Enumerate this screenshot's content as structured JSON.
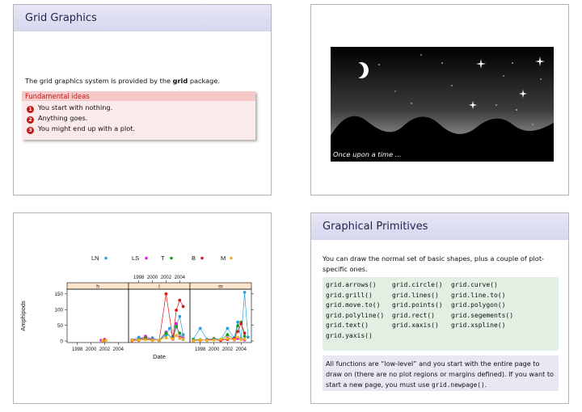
{
  "slide1": {
    "title": "Grid Graphics",
    "intro_before": "The grid graphics system is provided by the ",
    "intro_bold": "grid",
    "intro_after": " package.",
    "block_title": "Fundamental ideas",
    "items": [
      {
        "num": "1",
        "text": "You start with nothing."
      },
      {
        "num": "2",
        "text": "Anything goes."
      },
      {
        "num": "3",
        "text": "You might end up with a plot."
      }
    ],
    "accent": "#c41616"
  },
  "slide2": {
    "caption": "Once upon a time ..."
  },
  "slide3": {
    "chart_data": {
      "type": "line",
      "panels": [
        "h",
        "l",
        "m"
      ],
      "legend": [
        "LN",
        "LS",
        "T",
        "B",
        "M"
      ],
      "legend_colors": [
        "#2aa0dc",
        "#e020e0",
        "#11a011",
        "#e01515",
        "#f0b020"
      ],
      "xlabel": "Date",
      "ylabel": "Amphipods",
      "x_ticks": [
        "1998",
        "2000",
        "2002",
        "2004"
      ],
      "y_ticks": [
        "0",
        "50",
        "100",
        "150"
      ],
      "xlim": [
        1996.5,
        2005.5
      ],
      "ylim": [
        -5,
        165
      ],
      "series": [
        {
          "name": "LN",
          "color": "#2aa0dc",
          "data": [
            [],
            [
              [
                1997,
                3
              ],
              [
                1998,
                12
              ],
              [
                1999,
                5
              ],
              [
                2000,
                10
              ],
              [
                2001,
                3
              ],
              [
                2002,
                18
              ],
              [
                2002.5,
                40
              ],
              [
                2003,
                15
              ],
              [
                2003.5,
                50
              ],
              [
                2004,
                78
              ],
              [
                2004.5,
                20
              ]
            ],
            [
              [
                1997,
                6
              ],
              [
                1998,
                40
              ],
              [
                1999,
                5
              ],
              [
                2000,
                8
              ],
              [
                2001,
                5
              ],
              [
                2002,
                40
              ],
              [
                2003,
                10
              ],
              [
                2003.5,
                60
              ],
              [
                2004,
                8
              ],
              [
                2004.5,
                155
              ],
              [
                2005,
                12
              ]
            ]
          ]
        },
        {
          "name": "LS",
          "color": "#e020e0",
          "data": [
            [
              [
                2001.5,
                2
              ],
              [
                2002,
                5
              ]
            ],
            [
              [
                1997,
                3
              ],
              [
                1998,
                5
              ],
              [
                1999,
                15
              ],
              [
                2000,
                5
              ],
              [
                2001,
                2
              ],
              [
                2002,
                28
              ],
              [
                2003,
                5
              ],
              [
                2003.5,
                55
              ],
              [
                2004,
                12
              ],
              [
                2004.5,
                10
              ]
            ],
            [
              [
                1997,
                2
              ],
              [
                1998,
                4
              ],
              [
                1999,
                3
              ],
              [
                2000,
                5
              ],
              [
                2001,
                2
              ],
              [
                2002,
                10
              ],
              [
                2003,
                3
              ],
              [
                2003.5,
                8
              ],
              [
                2004,
                5
              ],
              [
                2004.5,
                3
              ]
            ]
          ]
        },
        {
          "name": "T",
          "color": "#11a011",
          "data": [
            [
              [
                2002,
                3
              ]
            ],
            [
              [
                1997,
                2
              ],
              [
                1998,
                4
              ],
              [
                1999,
                10
              ],
              [
                2000,
                3
              ],
              [
                2001,
                2
              ],
              [
                2002,
                25
              ],
              [
                2003,
                8
              ],
              [
                2003.5,
                45
              ],
              [
                2004,
                25
              ],
              [
                2004.5,
                5
              ]
            ],
            [
              [
                1997,
                3
              ],
              [
                1998,
                4
              ],
              [
                1999,
                2
              ],
              [
                2000,
                6
              ],
              [
                2001,
                3
              ],
              [
                2002,
                20
              ],
              [
                2003,
                5
              ],
              [
                2003.5,
                48
              ],
              [
                2004,
                60
              ],
              [
                2004.5,
                15
              ]
            ]
          ]
        },
        {
          "name": "B",
          "color": "#e01515",
          "data": [
            [
              [
                2002,
                2
              ]
            ],
            [
              [
                1997,
                1
              ],
              [
                1998,
                2
              ],
              [
                1999,
                6
              ],
              [
                2000,
                2
              ],
              [
                2001,
                3
              ],
              [
                2002,
                150
              ],
              [
                2003,
                8
              ],
              [
                2003.5,
                98
              ],
              [
                2004,
                130
              ],
              [
                2004.5,
                110
              ]
            ],
            [
              [
                1997,
                1
              ],
              [
                1998,
                2
              ],
              [
                1999,
                3
              ],
              [
                2000,
                4
              ],
              [
                2001,
                2
              ],
              [
                2002,
                5
              ],
              [
                2003,
                8
              ],
              [
                2003.5,
                30
              ],
              [
                2004,
                55
              ],
              [
                2004.5,
                25
              ]
            ]
          ]
        },
        {
          "name": "M",
          "color": "#f0b020",
          "data": [
            [
              [
                2001.7,
                1
              ],
              [
                2002.2,
                2
              ]
            ],
            [
              [
                1997,
                2
              ],
              [
                1998,
                3
              ],
              [
                1999,
                4
              ],
              [
                2000,
                2
              ],
              [
                2001,
                3
              ],
              [
                2002,
                10
              ],
              [
                2003,
                6
              ],
              [
                2003.5,
                18
              ],
              [
                2004,
                8
              ],
              [
                2004.5,
                6
              ]
            ],
            [
              [
                1997,
                1
              ],
              [
                1998,
                3
              ],
              [
                1999,
                2
              ],
              [
                2000,
                3
              ],
              [
                2001,
                5
              ],
              [
                2002,
                8
              ],
              [
                2003,
                4
              ],
              [
                2003.5,
                12
              ],
              [
                2004,
                5
              ],
              [
                2004.5,
                6
              ]
            ]
          ]
        }
      ]
    }
  },
  "slide4": {
    "title": "Graphical Primitives",
    "intro": "You can draw the normal set of basic shapes, plus a couple of plot-specific ones.",
    "functions": [
      "grid.arrows()",
      "grid.circle()",
      "grid.curve()",
      "grid.grill()",
      "grid.lines()",
      "grid.line.to()",
      "grid.move.to()",
      "grid.points()",
      "grid.polygon()",
      "grid.polyline()",
      "grid.rect()",
      "grid.segements()",
      "grid.text()",
      "grid.xaxis()",
      "grid.xspline()",
      "grid.yaxis()"
    ],
    "note_before": "All functions are “low-level” and you start with the entire page to draw on (there are no plot regions or margins defined). If you want to start a new page, you must use ",
    "note_code": "grid.newpage()",
    "note_after": ".",
    "code_bg": "#e3efe3",
    "note_bg": "#e8e8f4"
  }
}
